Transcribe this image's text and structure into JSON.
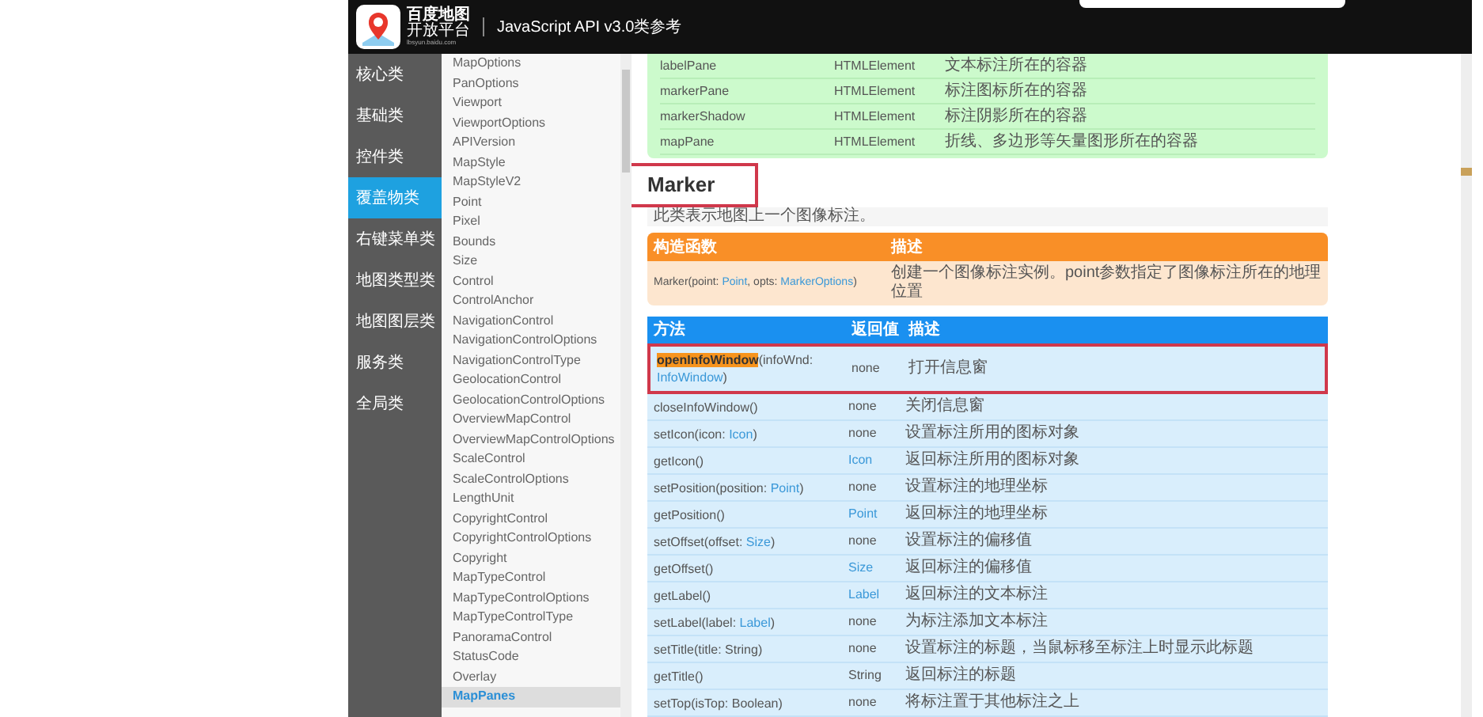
{
  "header": {
    "logo_title": "百度地图",
    "logo_subtitle": "开放平台",
    "logo_url": "lbsyun.baidu.com",
    "title": "JavaScript API v3.0类参考"
  },
  "nav": [
    {
      "label": "核心类",
      "selected": false
    },
    {
      "label": "基础类",
      "selected": false
    },
    {
      "label": "控件类",
      "selected": false
    },
    {
      "label": "覆盖物类",
      "selected": true
    },
    {
      "label": "右键菜单类",
      "selected": false
    },
    {
      "label": "地图类型类",
      "selected": false
    },
    {
      "label": "地图图层类",
      "selected": false
    },
    {
      "label": "服务类",
      "selected": false
    },
    {
      "label": "全局类",
      "selected": false
    }
  ],
  "class_list": [
    {
      "label": "MapOptions",
      "selected": false
    },
    {
      "label": "PanOptions",
      "selected": false
    },
    {
      "label": "Viewport",
      "selected": false
    },
    {
      "label": "ViewportOptions",
      "selected": false
    },
    {
      "label": "APIVersion",
      "selected": false
    },
    {
      "label": "MapStyle",
      "selected": false
    },
    {
      "label": "MapStyleV2",
      "selected": false
    },
    {
      "label": "Point",
      "selected": false
    },
    {
      "label": "Pixel",
      "selected": false
    },
    {
      "label": "Bounds",
      "selected": false
    },
    {
      "label": "Size",
      "selected": false
    },
    {
      "label": "Control",
      "selected": false
    },
    {
      "label": "ControlAnchor",
      "selected": false
    },
    {
      "label": "NavigationControl",
      "selected": false
    },
    {
      "label": "NavigationControlOptions",
      "selected": false
    },
    {
      "label": "NavigationControlType",
      "selected": false
    },
    {
      "label": "GeolocationControl",
      "selected": false
    },
    {
      "label": "GeolocationControlOptions",
      "selected": false
    },
    {
      "label": "OverviewMapControl",
      "selected": false
    },
    {
      "label": "OverviewMapControlOptions",
      "selected": false
    },
    {
      "label": "ScaleControl",
      "selected": false
    },
    {
      "label": "ScaleControlOptions",
      "selected": false
    },
    {
      "label": "LengthUnit",
      "selected": false
    },
    {
      "label": "CopyrightControl",
      "selected": false
    },
    {
      "label": "CopyrightControlOptions",
      "selected": false
    },
    {
      "label": "Copyright",
      "selected": false
    },
    {
      "label": "MapTypeControl",
      "selected": false
    },
    {
      "label": "MapTypeControlOptions",
      "selected": false
    },
    {
      "label": "MapTypeControlType",
      "selected": false
    },
    {
      "label": "PanoramaControl",
      "selected": false
    },
    {
      "label": "StatusCode",
      "selected": false
    },
    {
      "label": "Overlay",
      "selected": false
    },
    {
      "label": "MapPanes",
      "selected": true
    }
  ],
  "panes_table": {
    "rows": [
      {
        "name": "labelPane",
        "type": "HTMLElement",
        "description": "文本标注所在的容器"
      },
      {
        "name": "markerPane",
        "type": "HTMLElement",
        "description": "标注图标所在的容器"
      },
      {
        "name": "markerShadow",
        "type": "HTMLElement",
        "description": "标注阴影所在的容器"
      },
      {
        "name": "mapPane",
        "type": "HTMLElement",
        "description": "折线、多边形等矢量图形所在的容器"
      }
    ]
  },
  "heading": {
    "text": "Marker",
    "outlined": true
  },
  "class_description": "此类表示地图上一个图像标注。",
  "constructor_table": {
    "columns": [
      "构造函数",
      "描述"
    ],
    "rows": [
      {
        "signature": [
          {
            "text": "Marker(point: ",
            "kind": "plain"
          },
          {
            "text": "Point",
            "kind": "link"
          },
          {
            "text": ", opts: ",
            "kind": "plain"
          },
          {
            "text": "MarkerOptions",
            "kind": "link"
          },
          {
            "text": ")",
            "kind": "plain"
          }
        ],
        "description": "创建一个图像标注实例。point参数指定了图像标注所在的地理位置"
      }
    ]
  },
  "methods_table": {
    "columns": [
      "方法",
      "返回值",
      "描述"
    ],
    "rows": [
      {
        "outlined": true,
        "signature": [
          {
            "text": "openInfoWindow",
            "kind": "highlight"
          },
          {
            "text": "(infoWnd: ",
            "kind": "plain"
          },
          {
            "text": "InfoWindow",
            "kind": "link"
          },
          {
            "text": ")",
            "kind": "plain"
          }
        ],
        "returns": {
          "text": "none",
          "kind": "plain"
        },
        "description": "打开信息窗"
      },
      {
        "outlined": false,
        "signature": [
          {
            "text": "closeInfoWindow()",
            "kind": "plain"
          }
        ],
        "returns": {
          "text": "none",
          "kind": "plain"
        },
        "description": "关闭信息窗"
      },
      {
        "outlined": false,
        "signature": [
          {
            "text": "setIcon(icon: ",
            "kind": "plain"
          },
          {
            "text": "Icon",
            "kind": "link"
          },
          {
            "text": ")",
            "kind": "plain"
          }
        ],
        "returns": {
          "text": "none",
          "kind": "plain"
        },
        "description": "设置标注所用的图标对象"
      },
      {
        "outlined": false,
        "signature": [
          {
            "text": "getIcon()",
            "kind": "plain"
          }
        ],
        "returns": {
          "text": "Icon",
          "kind": "link"
        },
        "description": "返回标注所用的图标对象"
      },
      {
        "outlined": false,
        "signature": [
          {
            "text": "setPosition(position: ",
            "kind": "plain"
          },
          {
            "text": "Point",
            "kind": "link"
          },
          {
            "text": ")",
            "kind": "plain"
          }
        ],
        "returns": {
          "text": "none",
          "kind": "plain"
        },
        "description": "设置标注的地理坐标"
      },
      {
        "outlined": false,
        "signature": [
          {
            "text": "getPosition()",
            "kind": "plain"
          }
        ],
        "returns": {
          "text": "Point",
          "kind": "link"
        },
        "description": "返回标注的地理坐标"
      },
      {
        "outlined": false,
        "signature": [
          {
            "text": "setOffset(offset: ",
            "kind": "plain"
          },
          {
            "text": "Size",
            "kind": "link"
          },
          {
            "text": ")",
            "kind": "plain"
          }
        ],
        "returns": {
          "text": "none",
          "kind": "plain"
        },
        "description": "设置标注的偏移值"
      },
      {
        "outlined": false,
        "signature": [
          {
            "text": "getOffset()",
            "kind": "plain"
          }
        ],
        "returns": {
          "text": "Size",
          "kind": "link"
        },
        "description": "返回标注的偏移值"
      },
      {
        "outlined": false,
        "signature": [
          {
            "text": "getLabel()",
            "kind": "plain"
          }
        ],
        "returns": {
          "text": "Label",
          "kind": "link"
        },
        "description": "返回标注的文本标注"
      },
      {
        "outlined": false,
        "signature": [
          {
            "text": "setLabel(label: ",
            "kind": "plain"
          },
          {
            "text": "Label",
            "kind": "link"
          },
          {
            "text": ")",
            "kind": "plain"
          }
        ],
        "returns": {
          "text": "none",
          "kind": "plain"
        },
        "description": "为标注添加文本标注"
      },
      {
        "outlined": false,
        "signature": [
          {
            "text": "setTitle(title: String)",
            "kind": "plain"
          }
        ],
        "returns": {
          "text": "none",
          "kind": "plain"
        },
        "description": "设置标注的标题，当鼠标移至标注上时显示此标题"
      },
      {
        "outlined": false,
        "signature": [
          {
            "text": "getTitle()",
            "kind": "plain"
          }
        ],
        "returns": {
          "text": "String",
          "kind": "plain"
        },
        "description": "返回标注的标题"
      },
      {
        "outlined": false,
        "signature": [
          {
            "text": "setTop(isTop: Boolean)",
            "kind": "plain"
          }
        ],
        "returns": {
          "text": "none",
          "kind": "plain"
        },
        "description": "将标注置于其他标注之上"
      }
    ]
  }
}
